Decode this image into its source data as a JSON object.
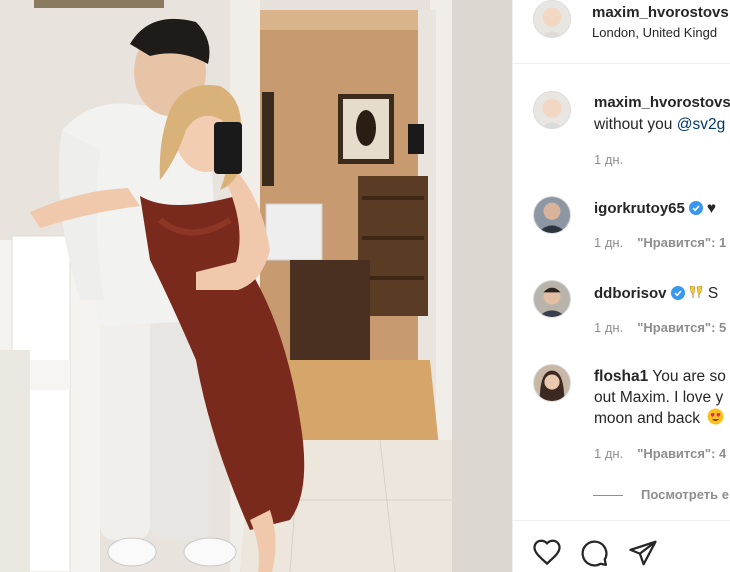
{
  "post": {
    "author": "maxim_hvorostovs",
    "location": "London, United Kingd"
  },
  "comments": [
    {
      "author": "maxim_hvorostovs",
      "lines": [
        "",
        "without you "
      ],
      "mention": "@sv2g",
      "time": "1 дн.",
      "likes": ""
    },
    {
      "author": "igorkrutoy65",
      "verified": true,
      "text": "♥",
      "time": "1 дн.",
      "likes": "\"Нравится\": 1"
    },
    {
      "author": "ddborisov",
      "verified": true,
      "emoji": "clinking-glasses",
      "text": " S",
      "time": "1 дн.",
      "likes": "\"Нравится\": 5"
    },
    {
      "author": "flosha1",
      "line1": "You are so",
      "line2": "out Maxim. I love y",
      "line3": "moon and back ",
      "emoji": "heart-eyes",
      "time": "1 дн.",
      "likes": "\"Нравится\": 4"
    }
  ],
  "view_more_label": "Посмотреть е",
  "actions": {
    "like_icon": "heart-icon",
    "comment_icon": "comment-icon",
    "share_icon": "share-icon"
  },
  "colors": {
    "verified": "#3897f0",
    "muted": "#8e8e8e",
    "mention": "#00376b",
    "dress": "#7a2a1c"
  }
}
